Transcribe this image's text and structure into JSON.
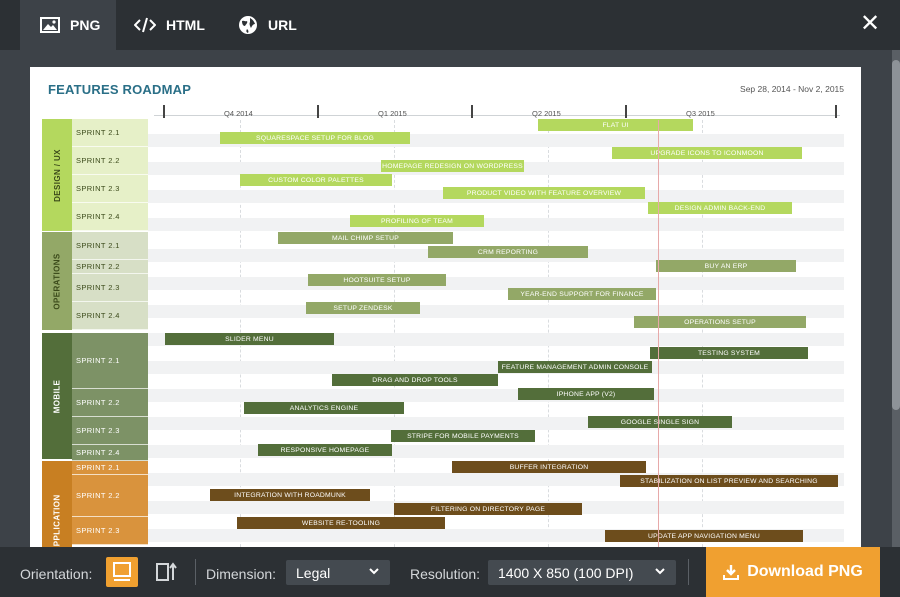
{
  "tabs": [
    {
      "label": "PNG",
      "icon": "image-icon"
    },
    {
      "label": "HTML",
      "icon": "code-icon"
    },
    {
      "label": "URL",
      "icon": "globe-icon"
    }
  ],
  "close_symbol": "✕",
  "roadmap": {
    "title": "FEATURES ROADMAP",
    "date_range": "Sep 28, 2014 - Nov 2, 2015",
    "timeline_labels": [
      "Q4 2014",
      "Q1 2015",
      "Q2 2015",
      "Q3 2015"
    ],
    "groups": [
      {
        "name": "DESIGN / UX",
        "color": "#b4d85e",
        "sprint_color": "#e6f0c8",
        "text_color": "#3b4a1a",
        "sprints": [
          "SPRINT 2.1",
          "SPRINT 2.2",
          "SPRINT 2.3",
          "SPRINT 2.4"
        ]
      },
      {
        "name": "OPERATIONS",
        "color": "#93a867",
        "sprint_color": "#d7dfc6",
        "text_color": "#3b4a1a",
        "sprints": [
          "SPRINT 2.1",
          "SPRINT 2.2",
          "SPRINT 2.3",
          "SPRINT 2.4"
        ]
      },
      {
        "name": "MOBILE",
        "color": "#536e3a",
        "sprint_color": "#7d9266",
        "text_color": "#ffffff",
        "sprints": [
          "SPRINT 2.1",
          "SPRINT 2.2",
          "SPRINT 2.3",
          "SPRINT 2.4"
        ]
      },
      {
        "name": "WEB APPLICATION",
        "color": "#c87f22",
        "sprint_color": "#d9933d",
        "text_color": "#ffffff",
        "sprints": [
          "SPRINT 2.1",
          "SPRINT 2.2",
          "SPRINT 2.3"
        ]
      }
    ],
    "bars": [
      "FLAT UI",
      "SQUARESPACE SETUP FOR BLOG",
      "UPGRADE ICONS TO ICONMOON",
      "HOMEPAGE REDESIGN ON WORDPRESS",
      "CUSTOM COLOR PALETTES",
      "PRODUCT VIDEO WITH FEATURE OVERVIEW",
      "DESIGN ADMIN BACK-END",
      "PROFILING OF TEAM",
      "MAIL CHIMP SETUP",
      "CRM REPORTING",
      "BUY AN ERP",
      "HOOTSUITE SETUP",
      "YEAR-END SUPPORT FOR FINANCE",
      "SETUP ZENDESK",
      "OPERATIONS SETUP",
      "SLIDER MENU",
      "TESTING SYSTEM",
      "FEATURE MANAGEMENT ADMIN CONSOLE",
      "DRAG AND DROP TOOLS",
      "IPHONE APP (V2)",
      "ANALYTICS ENGINE",
      "GOOGLE SINGLE SIGN",
      "STRIPE FOR MOBILE PAYMENTS",
      "RESPONSIVE HOMEPAGE",
      "BUFFER INTEGRATION",
      "STABILIZATION ON LIST PREVIEW AND SEARCHING",
      "INTEGRATION WITH ROADMUNK",
      "FILTERING ON DIRECTORY PAGE",
      "WEBSITE RE-TOOLING",
      "UPDATE APP NAVIGATION MENU"
    ]
  },
  "bottom": {
    "orientation_label": "Orientation:",
    "dimension_label": "Dimension:",
    "dimension_value": "Legal",
    "resolution_label": "Resolution:",
    "resolution_value": "1400 X 850 (100 DPI)",
    "download_label": "Download PNG"
  },
  "colors": {
    "accent": "#f0a030",
    "title": "#2a6f87"
  }
}
